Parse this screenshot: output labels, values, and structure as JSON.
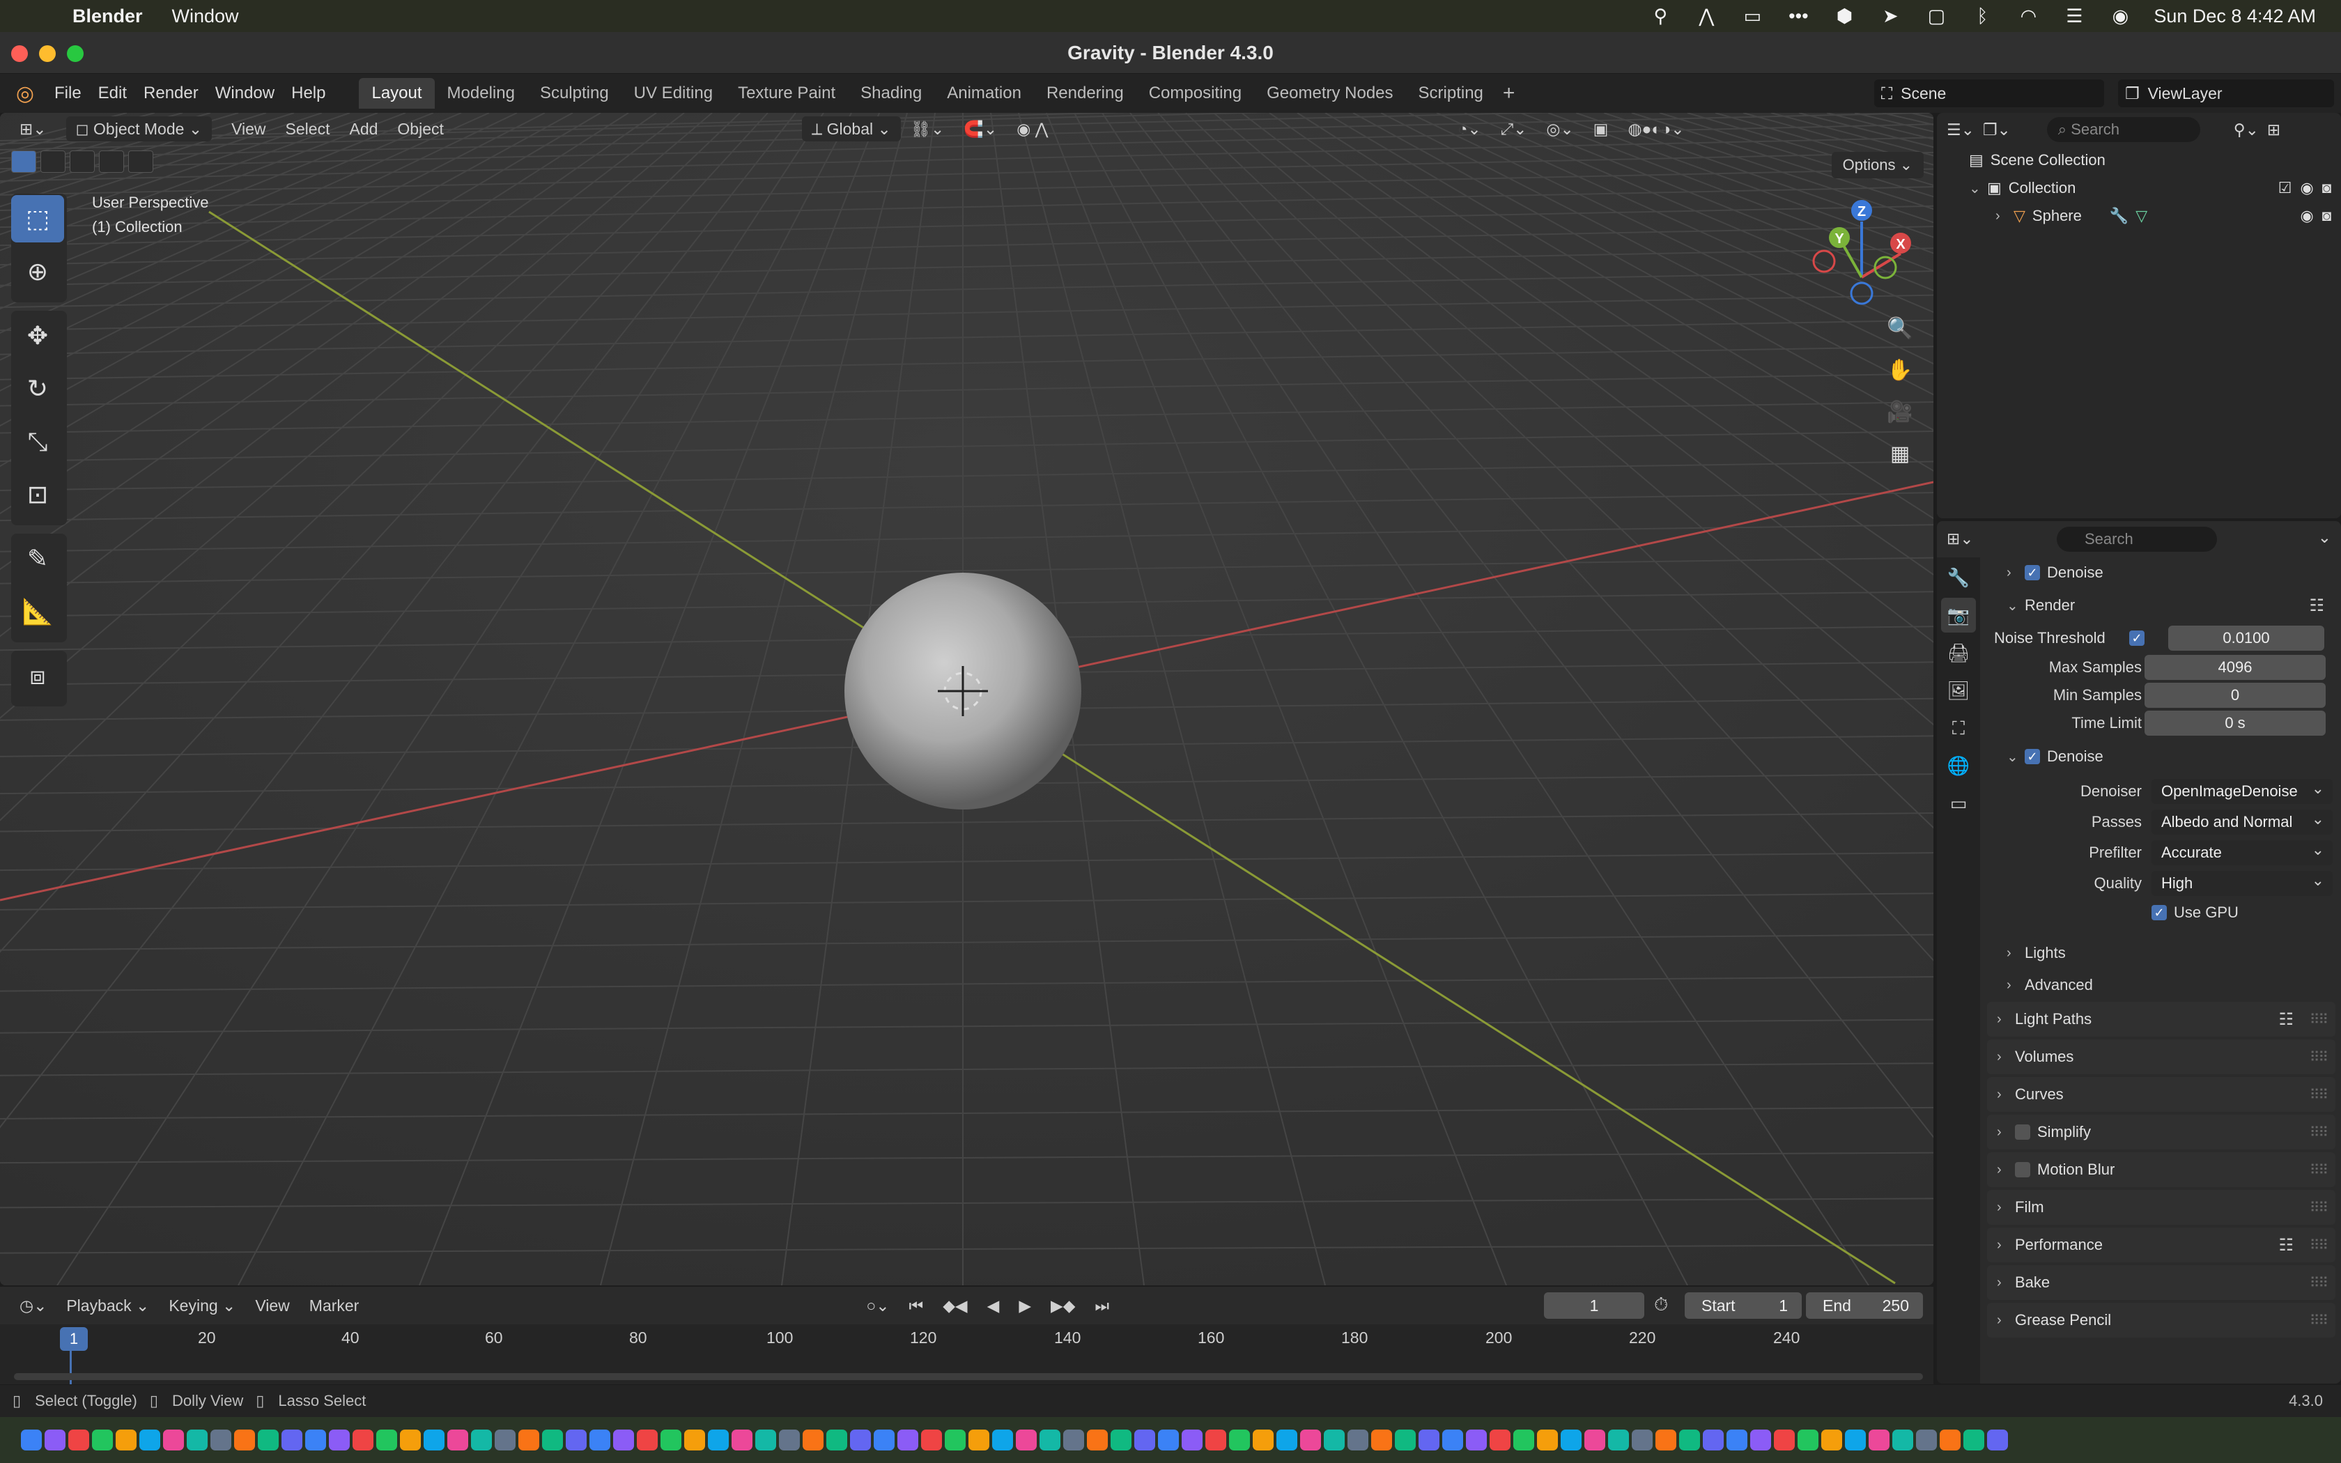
{
  "mac_menubar": {
    "app_name": "Blender",
    "menus": [
      "Window"
    ],
    "clock": "Sun Dec 8  4:42 AM"
  },
  "window": {
    "title": "Gravity - Blender 4.3.0"
  },
  "topbar": {
    "menus": [
      "File",
      "Edit",
      "Render",
      "Window",
      "Help"
    ],
    "tabs": [
      "Layout",
      "Modeling",
      "Sculpting",
      "UV Editing",
      "Texture Paint",
      "Shading",
      "Animation",
      "Rendering",
      "Compositing",
      "Geometry Nodes",
      "Scripting"
    ],
    "scene": "Scene",
    "view_layer": "ViewLayer"
  },
  "viewport": {
    "mode": "Object Mode",
    "menus": [
      "View",
      "Select",
      "Add",
      "Object"
    ],
    "orientation": "Global",
    "perspective_label": "User Perspective",
    "collection_label": "(1) Collection",
    "options_label": "Options",
    "gizmo": {
      "z": "Z",
      "y": "Y",
      "x": "X"
    }
  },
  "timeline": {
    "menus": [
      "Playback",
      "Keying",
      "View",
      "Marker"
    ],
    "current_frame": "1",
    "start_label": "Start",
    "start": "1",
    "end_label": "End",
    "end": "250",
    "ruler": [
      "1",
      "20",
      "40",
      "60",
      "80",
      "100",
      "120",
      "140",
      "160",
      "180",
      "200",
      "220",
      "240"
    ]
  },
  "statusbar": {
    "hints": [
      "Select (Toggle)",
      "Dolly View",
      "Lasso Select"
    ],
    "version": "4.3.0"
  },
  "outliner": {
    "search_placeholder": "Search",
    "scene_collection": "Scene Collection",
    "collection": "Collection",
    "object": "Sphere"
  },
  "properties": {
    "search_placeholder": "Search",
    "denoise_top": "Denoise",
    "render_section": "Render",
    "noise_threshold_label": "Noise Threshold",
    "noise_threshold": "0.0100",
    "max_samples_label": "Max Samples",
    "max_samples": "4096",
    "min_samples_label": "Min Samples",
    "min_samples": "0",
    "time_limit_label": "Time Limit",
    "time_limit": "0 s",
    "denoise_section": "Denoise",
    "denoiser_label": "Denoiser",
    "denoiser": "OpenImageDenoise",
    "passes_label": "Passes",
    "passes": "Albedo and Normal",
    "prefilter_label": "Prefilter",
    "prefilter": "Accurate",
    "quality_label": "Quality",
    "quality": "High",
    "use_gpu_label": "Use GPU",
    "lights": "Lights",
    "advanced": "Advanced",
    "panels": [
      "Light Paths",
      "Volumes",
      "Curves",
      "Simplify",
      "Motion Blur",
      "Film",
      "Performance",
      "Bake",
      "Grease Pencil"
    ]
  }
}
